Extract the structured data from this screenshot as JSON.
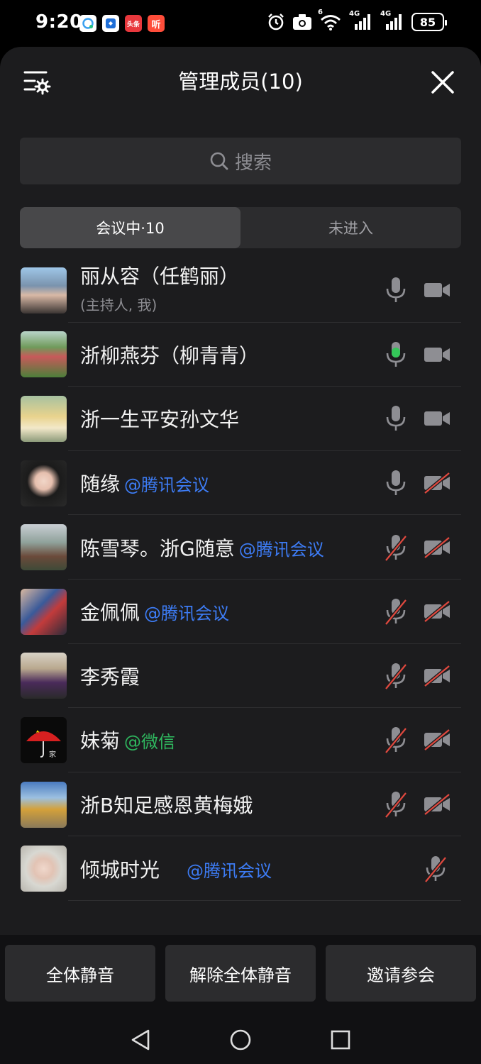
{
  "status": {
    "time": "9:20",
    "app_icons": [
      {
        "icon": "chat-bubble-app-icon",
        "color": "#3aa0f0"
      },
      {
        "icon": "bank-app-icon",
        "color": "#1f6fd8"
      },
      {
        "icon": "toutiao-app-icon",
        "color": "#e8383d",
        "label": "头条"
      },
      {
        "icon": "listen-app-icon",
        "color": "#ff4d3a",
        "label": "听"
      }
    ],
    "network1": "4G",
    "network2": "4G",
    "wifi_badge": "6",
    "battery": "85"
  },
  "header": {
    "title": "管理成员(10)"
  },
  "search": {
    "placeholder": "搜索"
  },
  "tabs": [
    {
      "label": "会议中·10",
      "active": true
    },
    {
      "label": "未进入",
      "active": false
    }
  ],
  "members": [
    {
      "name": "丽从容（任鹤丽）",
      "sub": "(主持人, 我)",
      "org": "",
      "mic": "on",
      "cam": "on"
    },
    {
      "name": "浙柳燕芬（柳青青）",
      "sub": "",
      "org": "",
      "mic": "speaking",
      "cam": "on"
    },
    {
      "name": "浙一生平安孙文华",
      "sub": "",
      "org": "",
      "mic": "on",
      "cam": "on"
    },
    {
      "name": "随缘",
      "sub": "",
      "org": "@腾讯会议",
      "mic": "on",
      "cam": "off"
    },
    {
      "name": "陈雪琴。浙G随意",
      "sub": "",
      "org": "@腾讯会议",
      "mic": "off",
      "cam": "off"
    },
    {
      "name": "金佩佩",
      "sub": "",
      "org": "@腾讯会议",
      "mic": "off",
      "cam": "off"
    },
    {
      "name": "李秀霞",
      "sub": "",
      "org": "",
      "mic": "off",
      "cam": "off"
    },
    {
      "name": "妹菊",
      "sub": "",
      "org": "@微信",
      "mic": "off",
      "cam": "off"
    },
    {
      "name": "浙B知足感恩黄梅娥",
      "sub": "",
      "org": "",
      "mic": "off",
      "cam": "off"
    },
    {
      "name": "倾城时光",
      "sub": "",
      "org": "@腾讯会议",
      "mic": "off",
      "cam": "none"
    }
  ],
  "footer": {
    "mute_all": "全体静音",
    "unmute_all": "解除全体静音",
    "invite": "邀请参会"
  },
  "colors": {
    "sheet_bg": "#1c1c1e",
    "tencent_tag": "#3d7cf5",
    "wechat_tag": "#2fb85f",
    "speaking_green": "#34c759",
    "muted_red": "#e0483e"
  }
}
